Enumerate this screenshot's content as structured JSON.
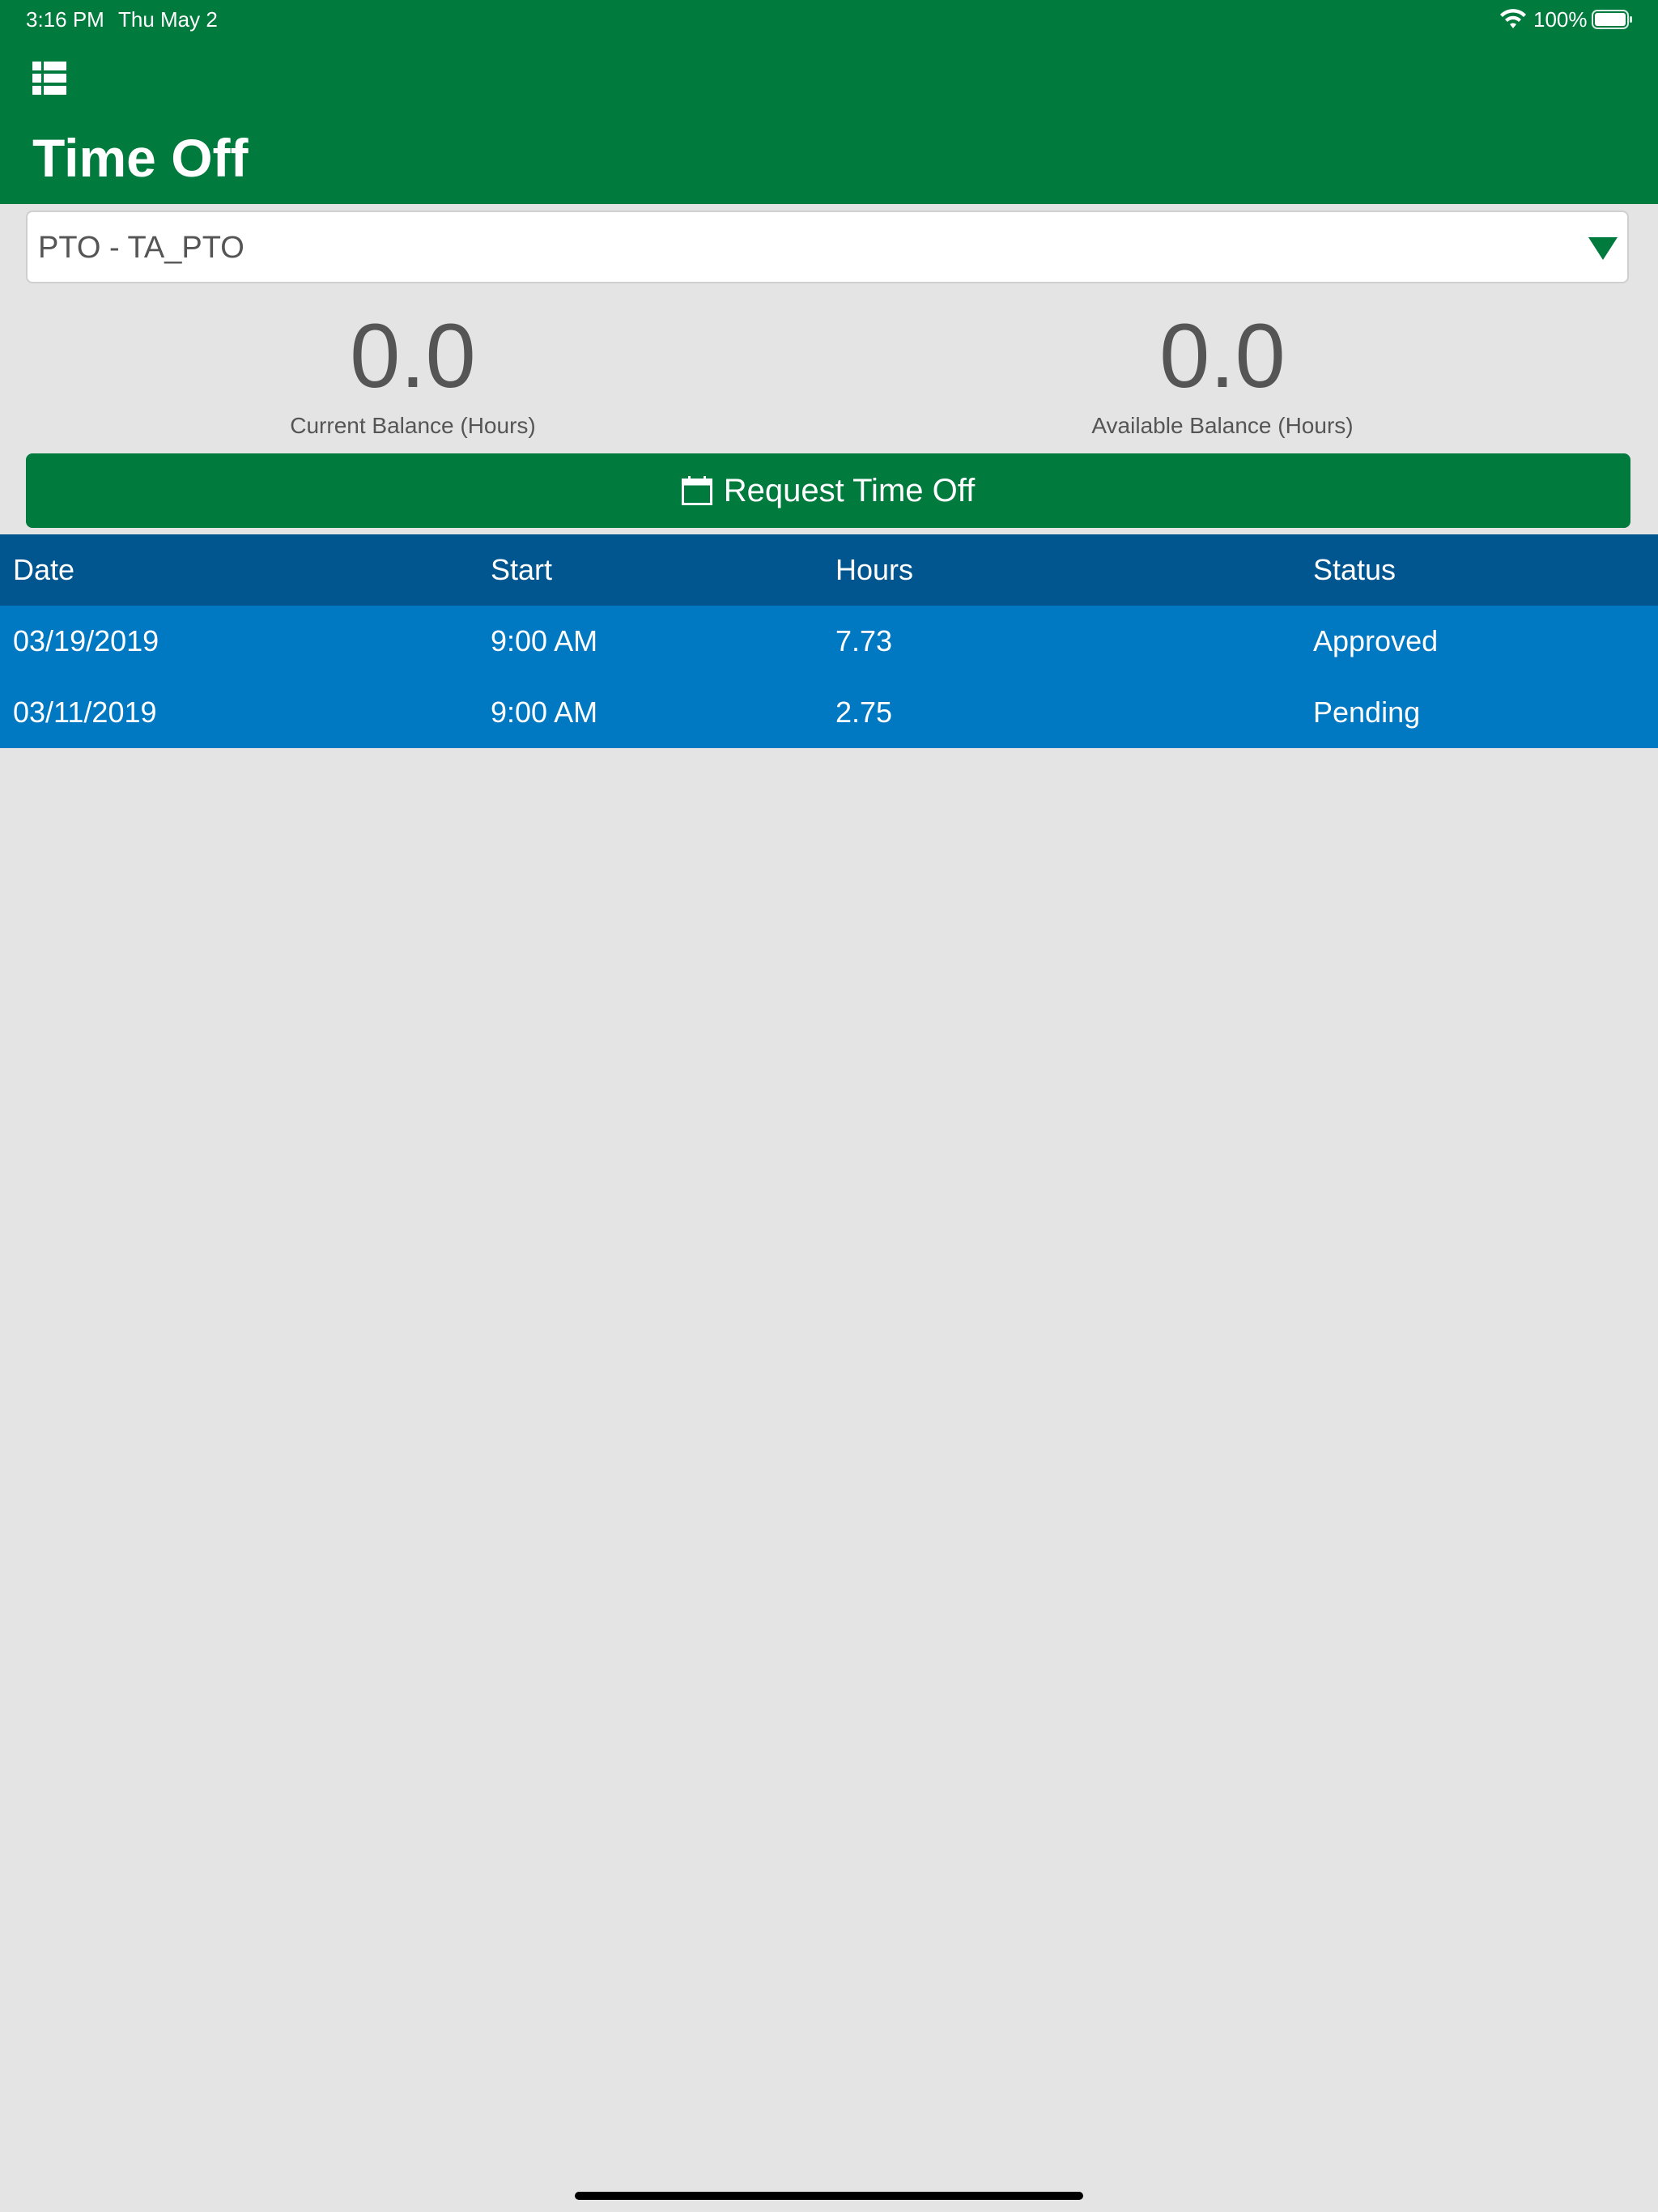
{
  "status_bar": {
    "time": "3:16 PM",
    "date": "Thu May 2",
    "battery": "100%",
    "icons": [
      "wifi-icon",
      "battery-icon"
    ]
  },
  "header": {
    "menu_icon": "list-icon",
    "title": "Time Off",
    "color": "#007a3d"
  },
  "dropdown": {
    "selected": "PTO - TA_PTO",
    "icon": "triangle-down-icon"
  },
  "balances": [
    {
      "value": "0.0",
      "label": "Current Balance (Hours)"
    },
    {
      "value": "0.0",
      "label": "Available Balance (Hours)"
    }
  ],
  "request_button": {
    "label": "Request Time Off",
    "icon": "calendar-icon"
  },
  "table": {
    "header_color": "#015690",
    "row_color": "#0078c2",
    "columns": [
      "Date",
      "Start",
      "Hours",
      "Status"
    ],
    "rows": [
      {
        "date": "03/19/2019",
        "start": "9:00 AM",
        "hours": "7.73",
        "status": "Approved"
      },
      {
        "date": "03/11/2019",
        "start": "9:00 AM",
        "hours": "2.75",
        "status": "Pending"
      }
    ]
  }
}
